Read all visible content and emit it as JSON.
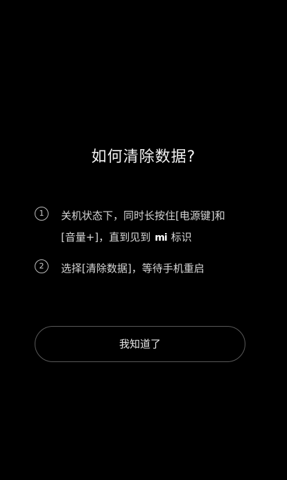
{
  "dialog": {
    "title": "如何清除数据?",
    "steps": [
      {
        "number": "1",
        "line1": "关机状态下，同时长按住[电源键]和",
        "line2_before_logo": "[音量+]，直到见到",
        "logo_text": "mi",
        "line2_after_logo": "标识"
      },
      {
        "number": "2",
        "line1": "选择[清除数据]，等待手机重启"
      }
    ],
    "confirm_button_label": "我知道了"
  }
}
